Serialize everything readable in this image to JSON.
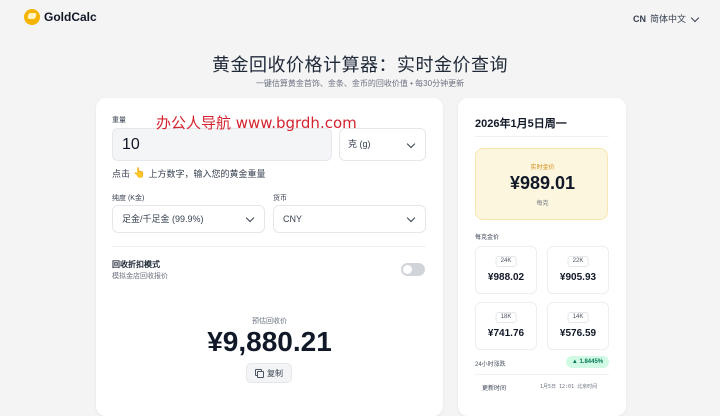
{
  "header": {
    "logo_text": "GoldCalc",
    "lang_code": "CN",
    "lang_name": "简体中文"
  },
  "hero": {
    "title": "黄金回收价格计算器：实时金价查询",
    "subtitle": "一键估算黄金首饰、金条、金币的回收价值 • 每30分钟更新"
  },
  "watermark": "办公人导航 www.bgrdh.com",
  "calculator": {
    "weight_label": "重量",
    "weight_value": "10",
    "unit_selected": "克 (g)",
    "hint_prefix": "点击",
    "hint_text": "上方数字，输入您的黄金重量",
    "purity_label": "纯度 (K金)",
    "purity_selected": "足金/千足金 (99.9%)",
    "currency_label": "货币",
    "currency_selected": "CNY",
    "recycle_title": "回收折扣模式",
    "recycle_sub": "模拟金店回收报价",
    "recycle_enabled": false,
    "estimate_label": "预估回收价",
    "estimate_value": "¥9,880.21",
    "copy_label": "复制"
  },
  "sidebar": {
    "date": "2026年1月5日周一",
    "live_label": "实时金价",
    "live_value": "¥989.01",
    "live_unit": "每克",
    "per_gram_label": "每克金价",
    "karats": [
      {
        "label": "24K",
        "value": "¥988.02"
      },
      {
        "label": "22K",
        "value": "¥905.93"
      },
      {
        "label": "18K",
        "value": "¥741.76"
      },
      {
        "label": "14K",
        "value": "¥576.59"
      }
    ],
    "change_label": "24小时涨跌",
    "change_value": "▲ 1.8445%",
    "update_label": "更新时间",
    "update_value": "1月5日 12:01 北京时间"
  },
  "colors": {
    "accent_gold": "#f5b301",
    "positive": "#047857",
    "watermark": "#d4232f"
  }
}
